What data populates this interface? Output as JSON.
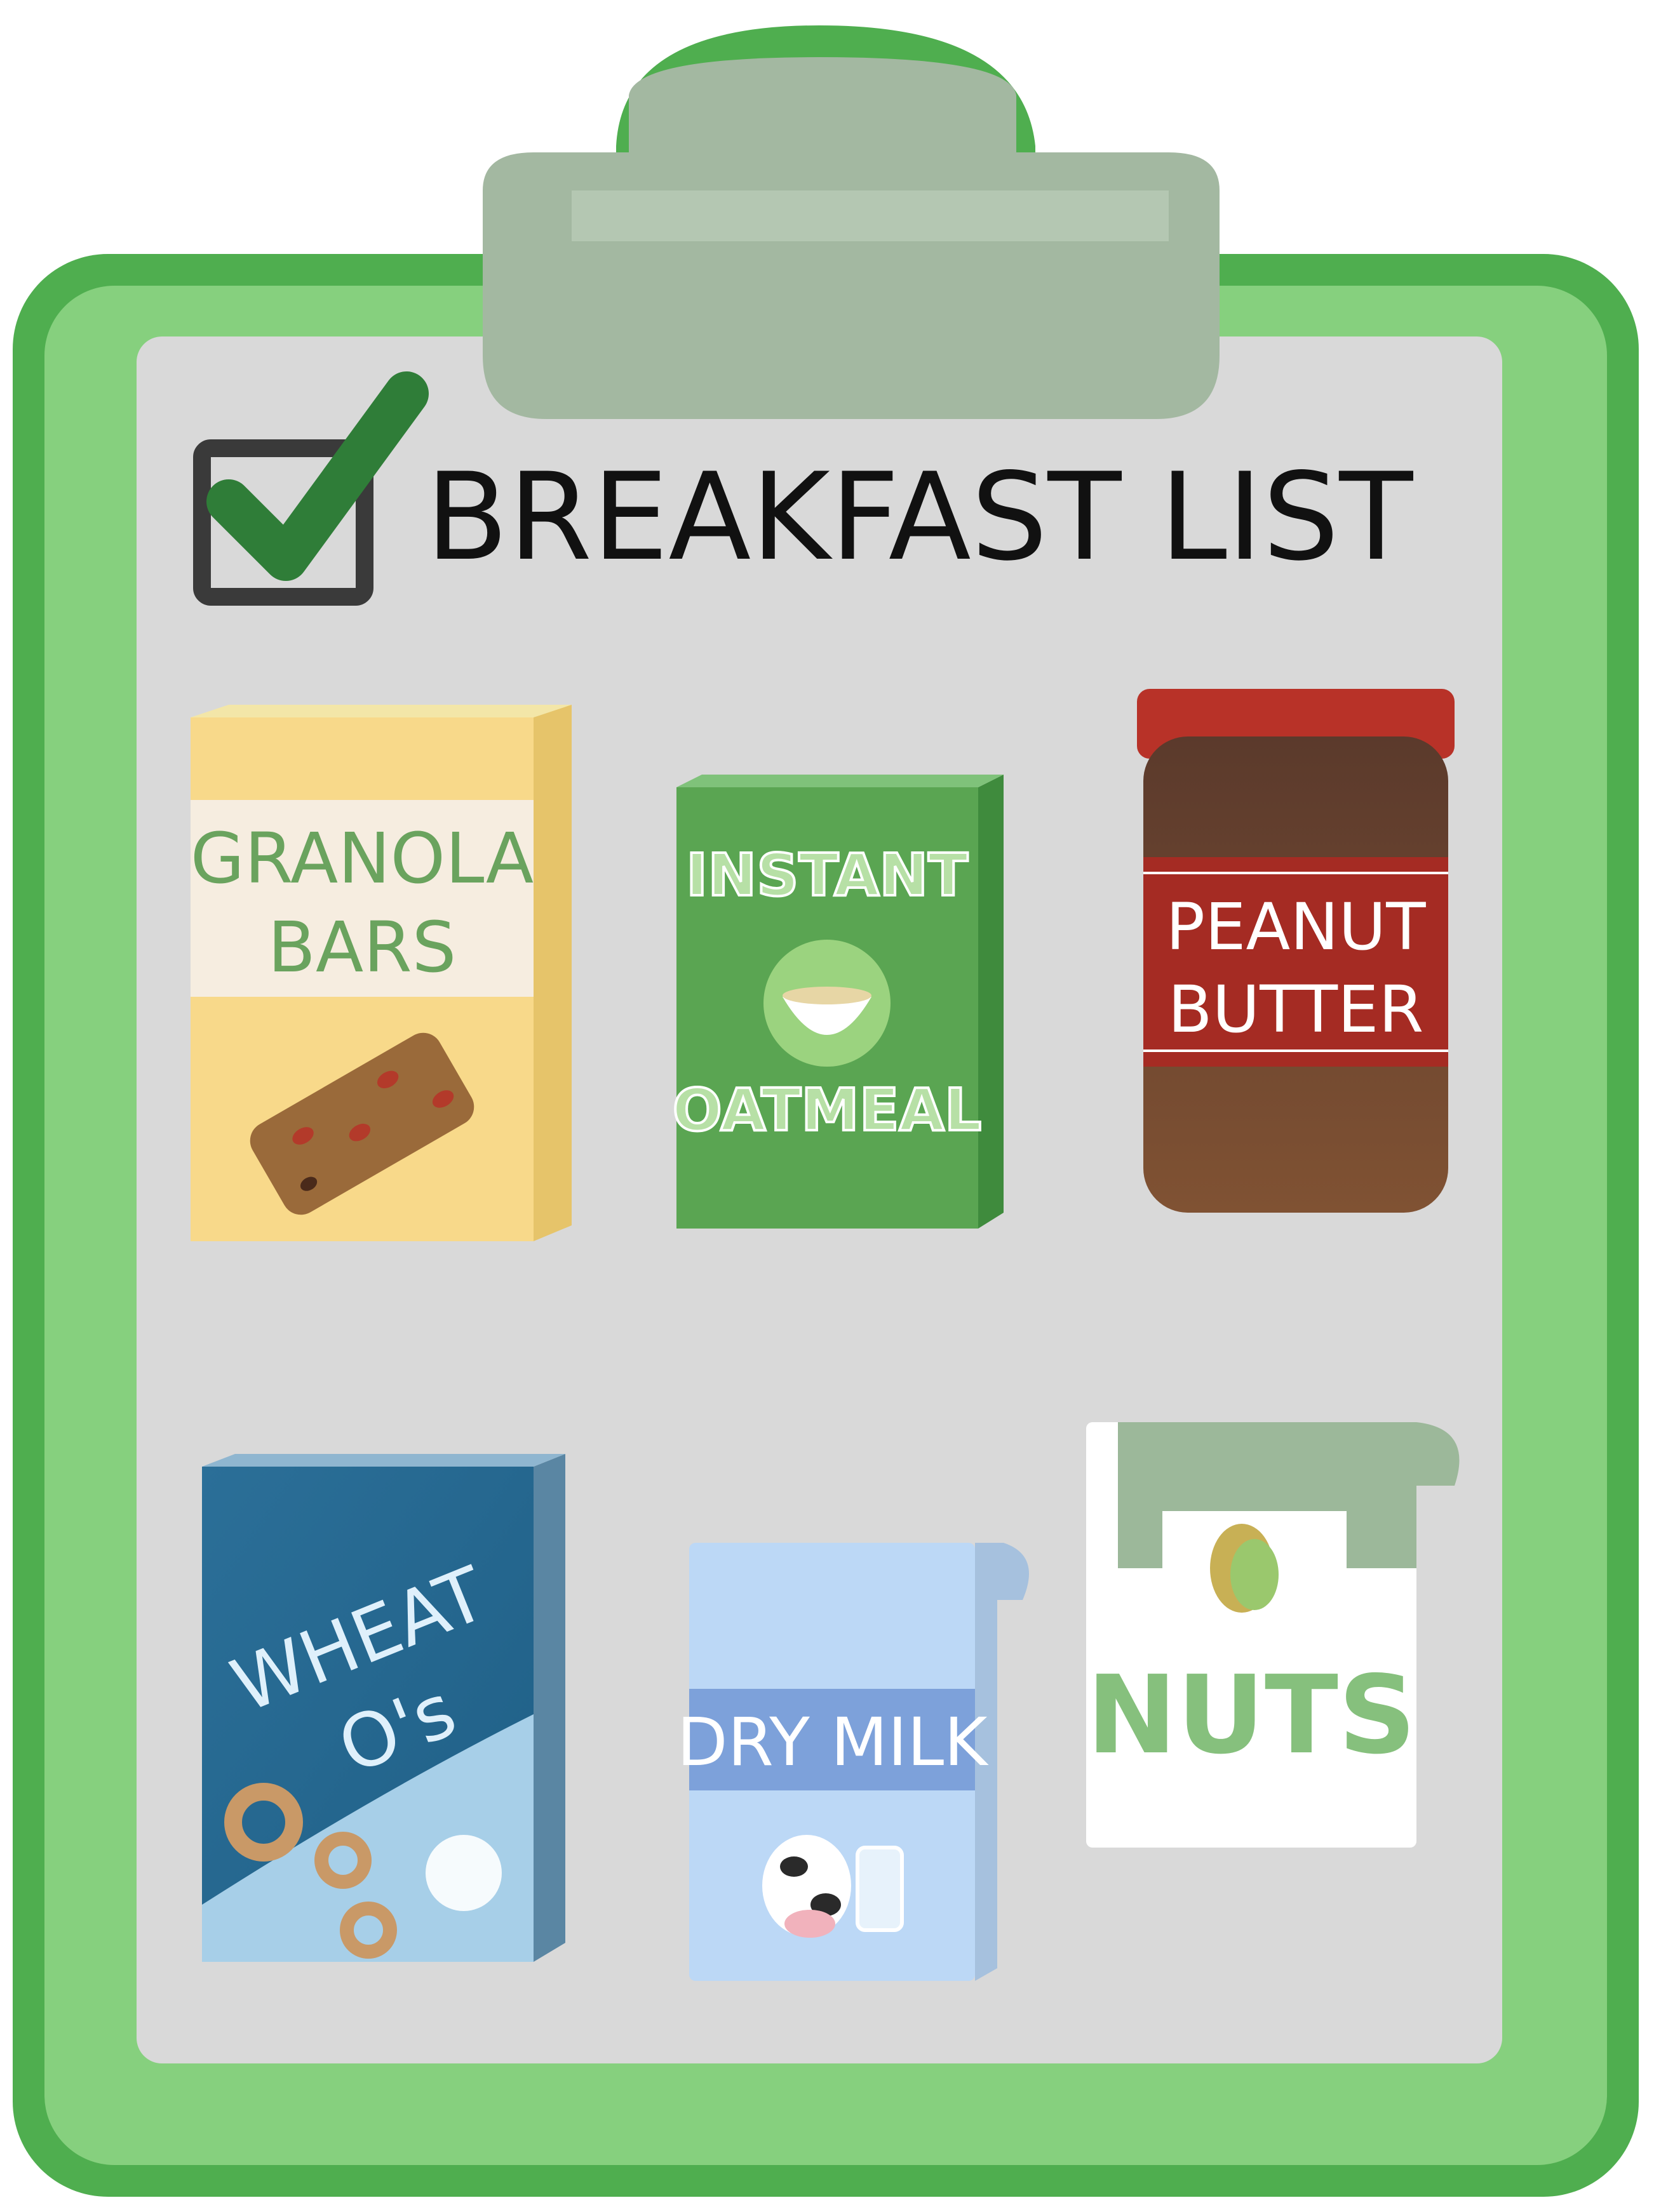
{
  "header": {
    "title": "BREAKFAST LIST",
    "checkbox_state": "checked"
  },
  "items": [
    {
      "name": "granola-bars",
      "label_lines": [
        "GRANOLA",
        "BARS"
      ],
      "container": "box",
      "color": "#f8d98a"
    },
    {
      "name": "instant-oatmeal",
      "label_lines": [
        "INSTANT",
        "OATMEAL"
      ],
      "container": "box",
      "color": "#5aa552"
    },
    {
      "name": "peanut-butter",
      "label_lines": [
        "PEANUT",
        "BUTTER"
      ],
      "container": "jar",
      "color": "#7a4a2f"
    },
    {
      "name": "wheat-os",
      "label_lines": [
        "WHEAT",
        "O's"
      ],
      "container": "box",
      "color": "#2a6b93"
    },
    {
      "name": "dry-milk",
      "label_lines": [
        "DRY MILK"
      ],
      "container": "bag",
      "color": "#bcd8f6"
    },
    {
      "name": "nuts",
      "label_lines": [
        "NUTS"
      ],
      "container": "bag",
      "color": "#ffffff"
    }
  ],
  "colors": {
    "clipboard_outer": "#4fae4f",
    "clipboard_inner": "#86d07e",
    "paper": "#d9d9d9",
    "clip": "#a3b8a1",
    "checkmark": "#2f7d38",
    "title_text": "#111111"
  }
}
